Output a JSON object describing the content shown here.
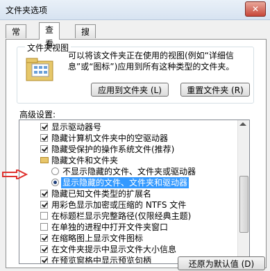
{
  "window": {
    "title": "文件夹选项",
    "close_label": "✕"
  },
  "tabs": [
    "常规",
    "查看",
    "搜索"
  ],
  "active_tab": 1,
  "folder_view": {
    "group_title": "文件夹视图",
    "description": "可以将该文件夹正在使用的视图(例如“详细信息”或“图标”)应用到所有这种类型的文件夹。",
    "apply_button": "应用到文件夹 (L)",
    "reset_button": "重置文件夹 (R)",
    "icon": "folder-view-icon"
  },
  "advanced": {
    "title": "高级设置:",
    "items": [
      {
        "type": "checkbox",
        "checked": true,
        "label": "显示驱动器号"
      },
      {
        "type": "checkbox",
        "checked": true,
        "label": "隐藏计算机文件夹中的空驱动器"
      },
      {
        "type": "checkbox",
        "checked": true,
        "label": "隐藏受保护的操作系统文件(推荐)"
      },
      {
        "type": "folder",
        "checked": false,
        "label": "隐藏文件和文件夹"
      },
      {
        "type": "radio",
        "checked": false,
        "label": "不显示隐藏的文件、文件夹或驱动器"
      },
      {
        "type": "radio",
        "checked": true,
        "label": "显示隐藏的文件、文件夹和驱动器",
        "selected": true
      },
      {
        "type": "checkbox",
        "checked": true,
        "label": "隐藏已知文件类型的扩展名"
      },
      {
        "type": "checkbox",
        "checked": true,
        "label": "用彩色显示加密或压缩的 NTFS 文件"
      },
      {
        "type": "checkbox",
        "checked": false,
        "label": "在标题栏显示完整路径(仅限经典主题)"
      },
      {
        "type": "checkbox",
        "checked": false,
        "label": "在单独的进程中打开文件夹窗口"
      },
      {
        "type": "checkbox",
        "checked": true,
        "label": "在缩略图上显示文件图标"
      },
      {
        "type": "checkbox",
        "checked": true,
        "label": "在文件夹提示中显示文件大小信息"
      },
      {
        "type": "checkbox",
        "checked": true,
        "label": "在预览窗格中显示预览句柄"
      }
    ]
  },
  "restore_button": "还原为默认值 (D)",
  "annotation": {
    "color": "#e0312d",
    "icon": "red-arrow-icon"
  }
}
